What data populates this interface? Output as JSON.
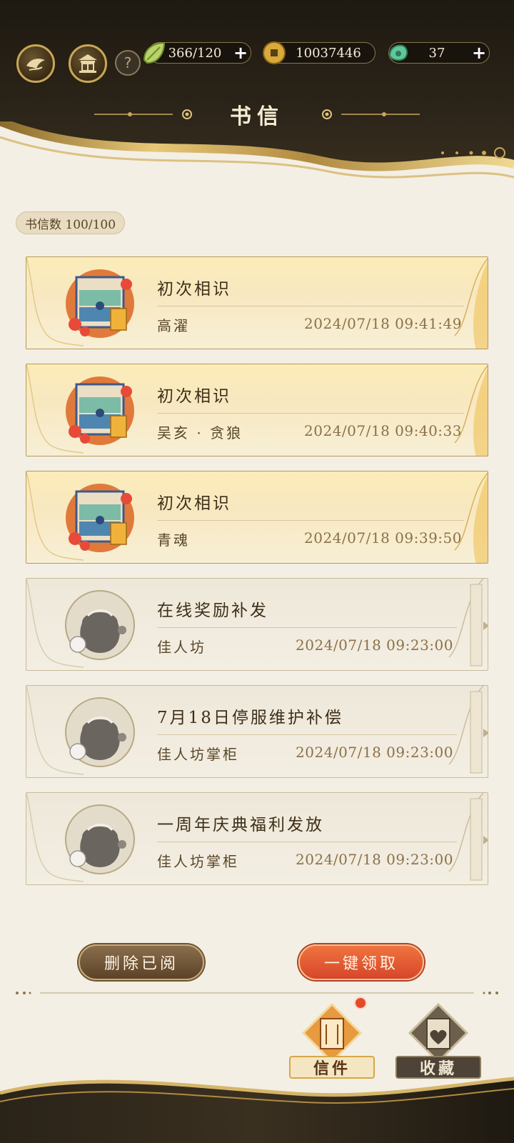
{
  "header": {
    "title": "书信",
    "resources": [
      {
        "name": "stamina",
        "value": "366/120",
        "has_plus": true,
        "icon": "leaf-icon"
      },
      {
        "name": "coins",
        "value": "10037446",
        "has_plus": false,
        "icon": "coin-icon"
      },
      {
        "name": "jade",
        "value": "37",
        "has_plus": true,
        "icon": "jade-icon"
      }
    ],
    "plus": "+",
    "help": "?"
  },
  "count": "书信数 100/100",
  "letters": [
    {
      "subject": "初次相识",
      "sender": "高濯",
      "time": "2024/07/18 09:41:49",
      "style": "gold",
      "icon": "wardrobe-chest-icon"
    },
    {
      "subject": "初次相识",
      "sender": "吴亥 · 贪狼",
      "time": "2024/07/18 09:40:33",
      "style": "gold",
      "icon": "wardrobe-chest-icon"
    },
    {
      "subject": "初次相识",
      "sender": "青魂",
      "time": "2024/07/18 09:39:50",
      "style": "gold",
      "icon": "wardrobe-chest-icon"
    },
    {
      "subject": "在线奖励补发",
      "sender": "佳人坊",
      "time": "2024/07/18 09:23:00",
      "style": "grey",
      "icon": "reward-pouch-icon"
    },
    {
      "subject": "7月18日停服维护补偿",
      "sender": "佳人坊掌柜",
      "time": "2024/07/18 09:23:00",
      "style": "grey",
      "icon": "reward-pouch-icon"
    },
    {
      "subject": "一周年庆典福利发放",
      "sender": "佳人坊掌柜",
      "time": "2024/07/18 09:23:00",
      "style": "grey",
      "icon": "reward-pouch-icon"
    }
  ],
  "actions": {
    "delete_read": "删除已阅",
    "claim_all": "一键领取"
  },
  "tabs": {
    "mail": "信件",
    "favorites": "收藏"
  },
  "colors": {
    "header_bg": "#1e1911",
    "gold_accent": "#c9a75a",
    "claim_button": "#d6462a",
    "badge": "#e24a2c"
  }
}
